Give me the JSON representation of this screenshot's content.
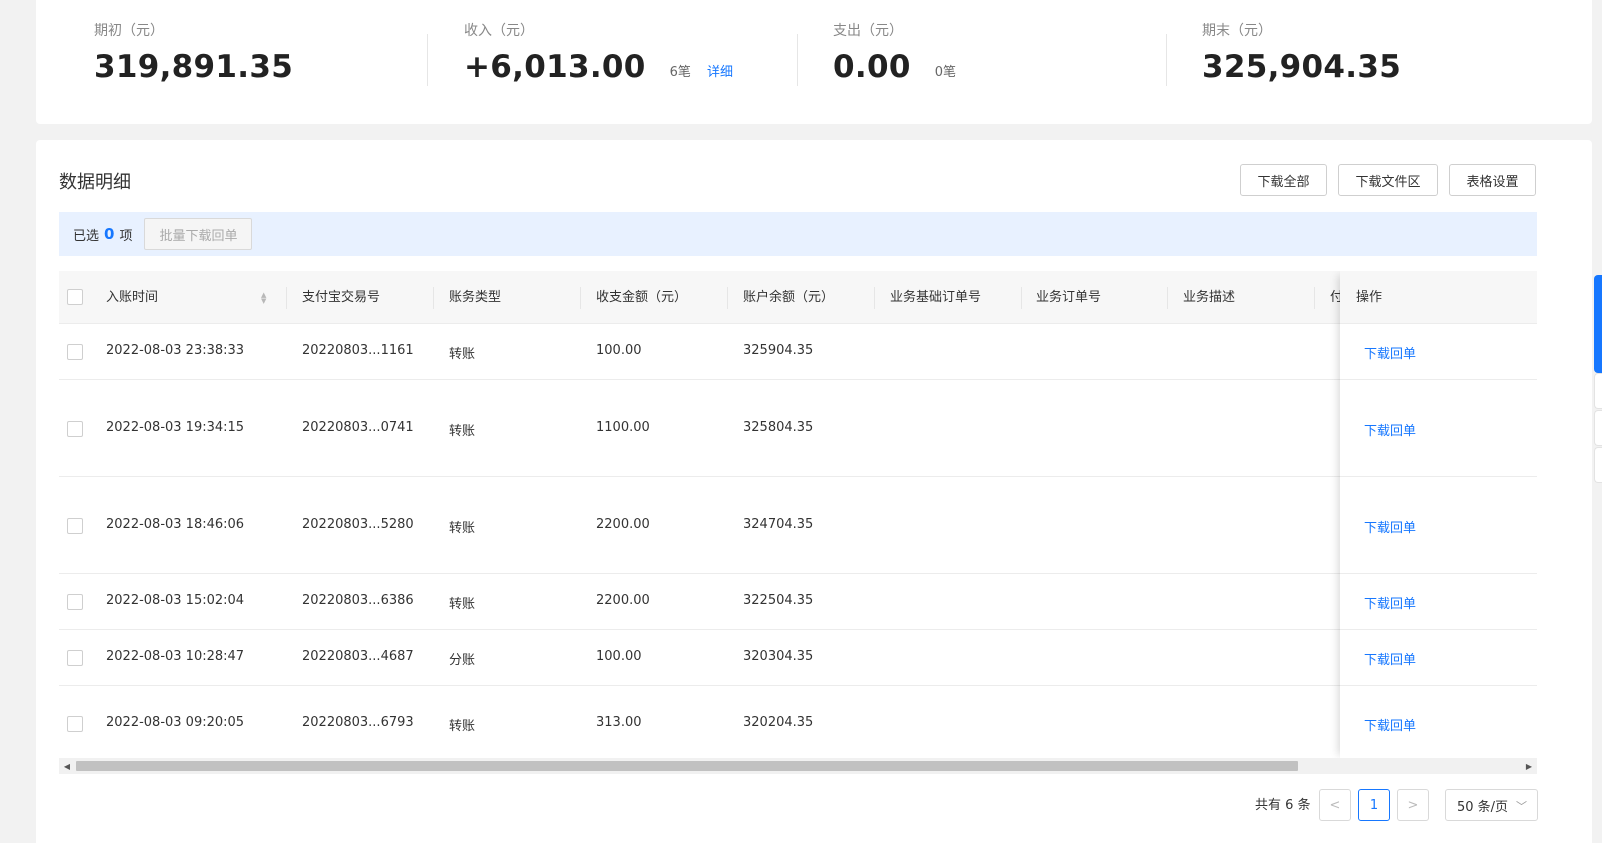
{
  "summary": {
    "opening": {
      "label": "期初（元）",
      "value": "319,891.35"
    },
    "income": {
      "label": "收入（元）",
      "value": "+6,013.00",
      "count": "6笔",
      "detail_link": "详细"
    },
    "expense": {
      "label": "支出（元）",
      "value": "0.00",
      "count": "0笔"
    },
    "closing": {
      "label": "期末（元）",
      "value": "325,904.35"
    }
  },
  "detail": {
    "title": "数据明细",
    "buttons": {
      "download_all": "下载全部",
      "download_area": "下载文件区",
      "table_settings": "表格设置"
    },
    "selection": {
      "prefix": "已选",
      "count": "0",
      "suffix": "项",
      "batch_button": "批量下载回单"
    }
  },
  "table": {
    "columns": [
      "入账时间",
      "支付宝交易号",
      "账务类型",
      "收支金额（元）",
      "账户余额（元）",
      "业务基础订单号",
      "业务订单号",
      "业务描述",
      "付"
    ],
    "action_column": "操作",
    "rows": [
      {
        "time": "2022-08-03 23:38:33",
        "trade_no": "20220803...1161",
        "type": "转账",
        "amount": "100.00",
        "balance": "325904.35",
        "action": "下载回单"
      },
      {
        "time": "2022-08-03 19:34:15",
        "trade_no": "20220803...0741",
        "type": "转账",
        "amount": "1100.00",
        "balance": "325804.35",
        "action": "下载回单"
      },
      {
        "time": "2022-08-03 18:46:06",
        "trade_no": "20220803...5280",
        "type": "转账",
        "amount": "2200.00",
        "balance": "324704.35",
        "action": "下载回单"
      },
      {
        "time": "2022-08-03 15:02:04",
        "trade_no": "20220803...6386",
        "type": "转账",
        "amount": "2200.00",
        "balance": "322504.35",
        "action": "下载回单"
      },
      {
        "time": "2022-08-03 10:28:47",
        "trade_no": "20220803...4687",
        "type": "分账",
        "amount": "100.00",
        "balance": "320304.35",
        "action": "下载回单"
      },
      {
        "time": "2022-08-03 09:20:05",
        "trade_no": "20220803...6793",
        "type": "转账",
        "amount": "313.00",
        "balance": "320204.35",
        "action": "下载回单"
      }
    ]
  },
  "pagination": {
    "total": "共有 6 条",
    "prev": "<",
    "current": "1",
    "next": ">",
    "page_size": "50 条/页"
  },
  "icons": {
    "sort": "sort-icon",
    "prev": "chevron-left-icon",
    "next": "chevron-right-icon",
    "dropdown": "chevron-down-icon"
  },
  "colors": {
    "accent": "#1677ff",
    "selection_bar": "#e8f1ff"
  }
}
